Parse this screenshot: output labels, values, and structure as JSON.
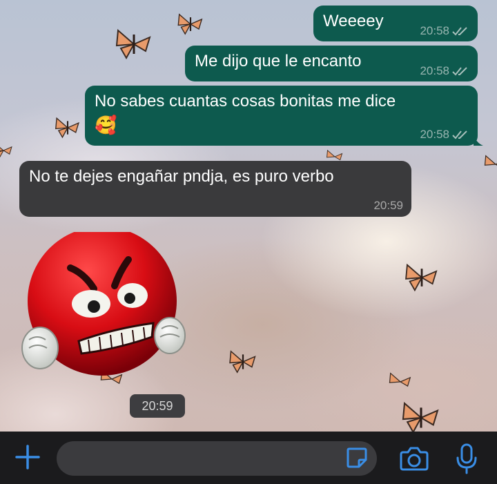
{
  "colors": {
    "outgoing_bubble": "#0d5a4e",
    "incoming_bubble": "#3a3a3c",
    "accent": "#3a8ee6",
    "bottom_bar": "#1b1b1d"
  },
  "messages": [
    {
      "direction": "outgoing",
      "text": "Weeeey",
      "time": "20:58",
      "status": "read-double-check-icon"
    },
    {
      "direction": "outgoing",
      "text": "Me dijo que le encanto",
      "time": "20:58",
      "status": "read-double-check-icon"
    },
    {
      "direction": "outgoing",
      "text": "No sabes cuantas cosas bonitas me dice",
      "emoji": "🥰",
      "time": "20:58",
      "status": "read-double-check-icon"
    },
    {
      "direction": "incoming",
      "text": "No te dejes engañar pndja, es puro verbo",
      "time": "20:59"
    },
    {
      "direction": "incoming",
      "type": "sticker",
      "sticker": "angry-red-emoji-sticker",
      "time": "20:59"
    }
  ],
  "composer": {
    "attach_icon": "plus-icon",
    "sticker_icon": "sticker-icon",
    "camera_icon": "camera-icon",
    "mic_icon": "microphone-icon"
  }
}
